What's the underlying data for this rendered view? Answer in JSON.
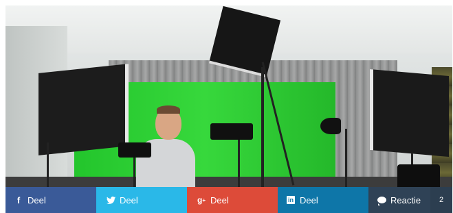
{
  "colors": {
    "facebook": "#3a5a98",
    "twitter": "#2ab8e8",
    "googleplus": "#dd4b39",
    "linkedin": "#0e76a8",
    "comment": "#2f4256"
  },
  "share_bar": {
    "facebook": {
      "label": "Deel",
      "icon": "facebook-icon"
    },
    "twitter": {
      "label": "Deel",
      "icon": "twitter-icon"
    },
    "googleplus": {
      "label": "Deel",
      "icon": "google-plus-icon"
    },
    "linkedin": {
      "label": "Deel",
      "icon": "linkedin-icon"
    },
    "comment": {
      "label": "Reactie",
      "icon": "comment-icon",
      "count": "2"
    }
  }
}
